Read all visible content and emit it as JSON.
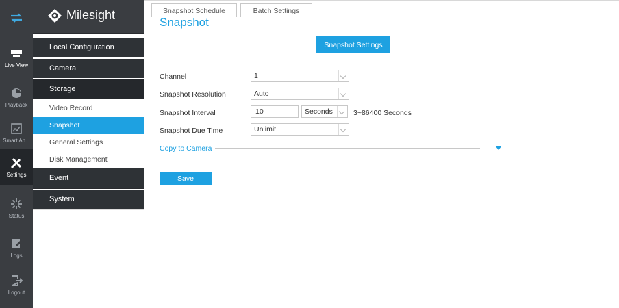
{
  "rail": {
    "items": [
      {
        "label": "",
        "icon": "swap-arrows-icon"
      },
      {
        "label": "Live View",
        "icon": "monitor-icon"
      },
      {
        "label": "Playback",
        "icon": "playback-icon"
      },
      {
        "label": "Smart An...",
        "icon": "smart-analysis-icon"
      },
      {
        "label": "Settings",
        "icon": "wrench-screwdriver-icon"
      },
      {
        "label": "Status",
        "icon": "status-icon"
      },
      {
        "label": "Logs",
        "icon": "logs-icon"
      },
      {
        "label": "Logout",
        "icon": "logout-icon"
      }
    ]
  },
  "brand": {
    "name": "Milesight",
    "icon": "milesight-logo-icon"
  },
  "nav": {
    "local_configuration": "Local Configuration",
    "camera": "Camera",
    "storage": "Storage",
    "video_record": "Video Record",
    "snapshot": "Snapshot",
    "general_settings": "General Settings",
    "disk_management": "Disk Management",
    "event": "Event",
    "system": "System"
  },
  "page": {
    "title": "Snapshot",
    "tabs": [
      "Snapshot Schedule",
      "Batch Settings",
      "Snapshot Settings"
    ],
    "active_tab": "Snapshot Settings"
  },
  "form": {
    "channel": {
      "label": "Channel",
      "value": "1"
    },
    "resolution": {
      "label": "Snapshot Resolution",
      "value": "Auto"
    },
    "interval": {
      "label": "Snapshot Interval",
      "value": "10",
      "unit": "Seconds",
      "hint": "3~86400 Seconds"
    },
    "due_time": {
      "label": "Snapshot Due Time",
      "value": "Unlimit"
    },
    "copy_to_camera": "Copy to Camera",
    "save": "Save"
  },
  "colors": {
    "accent": "#1ea1e1",
    "rail_bg": "#3a3d41",
    "section_bg": "#2e3236"
  }
}
